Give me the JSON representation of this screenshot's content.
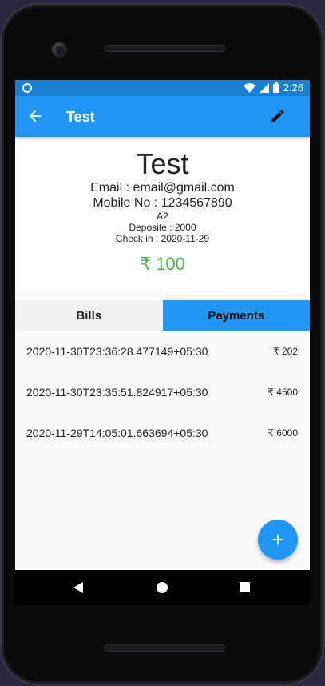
{
  "status_bar": {
    "time": "2:26"
  },
  "app_bar": {
    "title": "Test"
  },
  "customer": {
    "name": "Test",
    "email_line": "Email : email@gmail.com",
    "mobile_line": "Mobile No : 1234567890",
    "room": "A2",
    "deposit_line": "Deposite : 2000",
    "checkin_line": "Check in : 2020-11-29",
    "balance": "₹ 100"
  },
  "tabs": [
    {
      "label": "Bills",
      "selected": false
    },
    {
      "label": "Payments",
      "selected": true
    }
  ],
  "payments": [
    {
      "timestamp": "2020-11-30T23:36:28.477149+05:30",
      "amount": "₹ 202"
    },
    {
      "timestamp": "2020-11-30T23:35:51.824917+05:30",
      "amount": "₹ 4500"
    },
    {
      "timestamp": "2020-11-29T14:05:01.663694+05:30",
      "amount": "₹ 6000"
    }
  ],
  "fab": {
    "icon": "plus-icon",
    "label": "+"
  },
  "colors": {
    "primary": "#2196f3",
    "status_bar": "#1a7fd1",
    "balance": "#4caf50"
  }
}
